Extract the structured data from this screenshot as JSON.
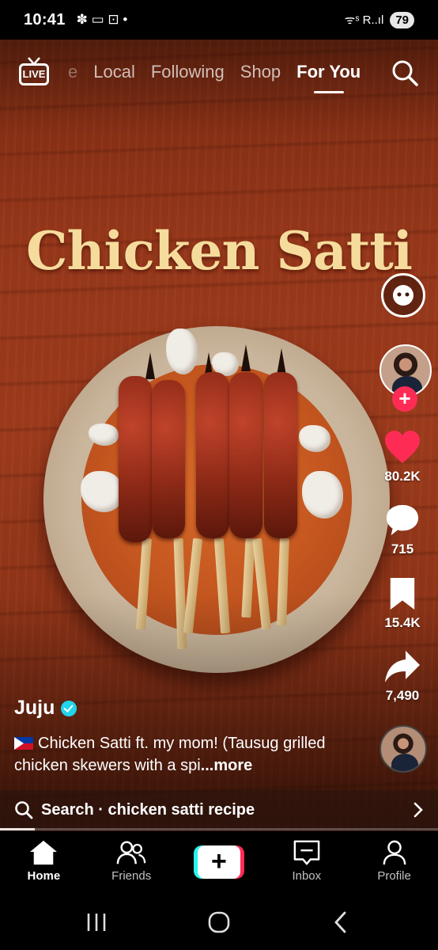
{
  "status_bar": {
    "time": "10:41",
    "battery": "79",
    "notif_glyphs": "✽ ▭ ⊡ •",
    "signal": "ᯤˢ R..ıl"
  },
  "top_nav": {
    "live_label": "LIVE",
    "tabs": [
      {
        "label": "e",
        "state": "faded"
      },
      {
        "label": "Local",
        "state": "inactive"
      },
      {
        "label": "Following",
        "state": "inactive"
      },
      {
        "label": "Shop",
        "state": "inactive"
      },
      {
        "label": "For You",
        "state": "active"
      }
    ]
  },
  "video": {
    "overlay_title": "Chicken Satti"
  },
  "actions": {
    "likes": "80.2K",
    "comments": "715",
    "bookmarks": "15.4K",
    "shares": "7,490",
    "follow_glyph": "+"
  },
  "post": {
    "username": "Juju",
    "verified": true,
    "caption": "Chicken Satti ft. my mom! (Tausug grilled chicken skewers with a spi",
    "more_label": "...more"
  },
  "search_suggestion": {
    "label": "Search · chicken satti recipe"
  },
  "progress_fraction": 0.08,
  "bottom_nav": {
    "home": "Home",
    "friends": "Friends",
    "create_glyph": "+",
    "inbox": "Inbox",
    "profile": "Profile"
  },
  "colors": {
    "like": "#fe2c55",
    "verified": "#20d5ec",
    "title": "#f6dc9c"
  }
}
